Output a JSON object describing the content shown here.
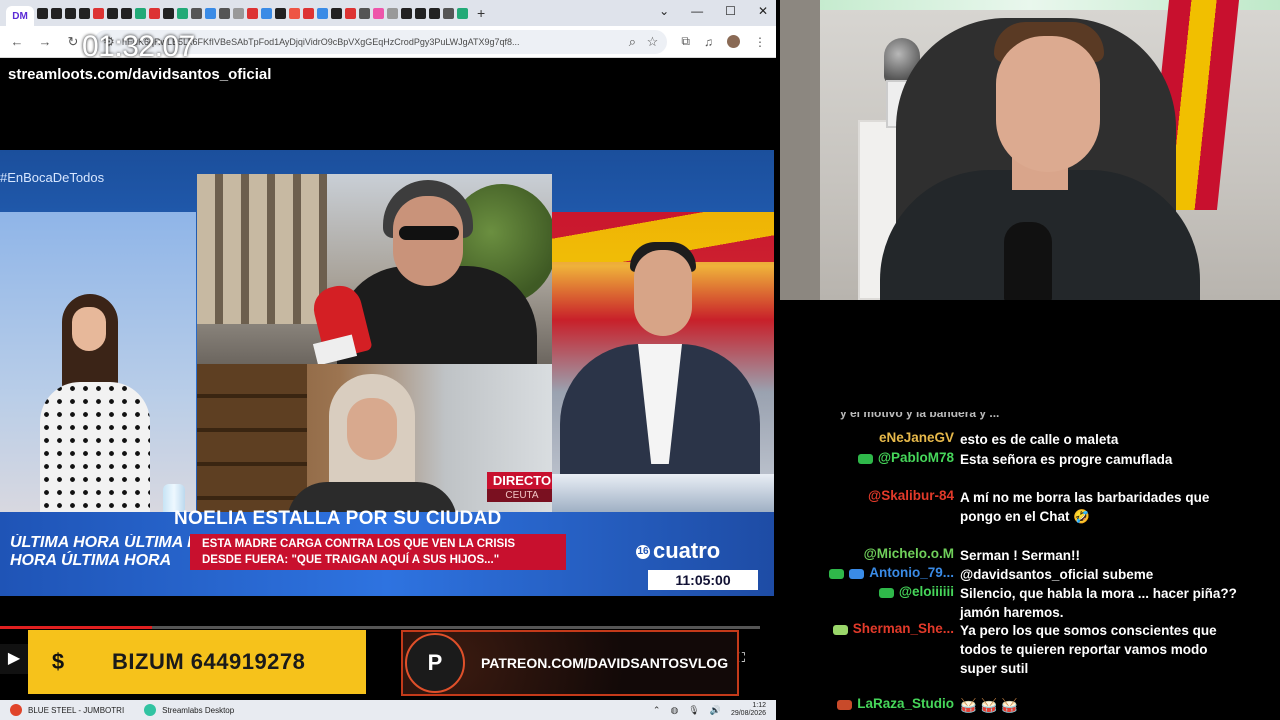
{
  "browser": {
    "url": "hEuK6qRwLB5Lk6FKfIVBeSAbTpFod1AyDjqiVidrO9cBpVXgGEqHzCrodPgy3PuLWJgATX9g7qf8...",
    "active_tab_label": "DM",
    "new_tab_symbol": "+",
    "window_controls": [
      "⌄",
      "—",
      "☐",
      "✕"
    ]
  },
  "overlay": {
    "clock": "01:32:07",
    "streamloots": "streamloots.com/davidsantos_oficial"
  },
  "tv": {
    "hashtag": "#EnBocaDeTodos",
    "ultima_lines": [
      "ÚLTIMA HORA   ÚLTIMA HORA",
      "HORA   ÚLTIMA HORA"
    ],
    "directo": "DIRECTO",
    "location": "CEUTA",
    "headline": "NOELIA ESTALLA POR SU CIUDAD",
    "subheadline": "ESTA MADRE CARGA CONTRA LOS QUE VEN LA CRISIS DESDE FUERA: \"QUE TRAIGAN AQUÍ A SUS HIJOS...\"",
    "channel": "cuatro",
    "channel_badge": "16",
    "time": "11:05:00"
  },
  "player": {
    "progress_fraction": 0.2
  },
  "donations": {
    "bizum_symbol": "$",
    "bizum": "BIZUM 644919278",
    "patreon_symbol": "P",
    "patreon": "PATREON.COM/DAVIDSANTOSVLOG"
  },
  "taskbar": {
    "apps": [
      {
        "label": "BLUE STEEL - JUMBOTRI",
        "color": "#e0442a"
      },
      {
        "label": "Streamlabs Desktop",
        "color": "#31c3a2"
      }
    ],
    "time": "1:12",
    "date": "29/08/2026"
  },
  "chat": {
    "partial_top": "y el motivo y la bandera y ...",
    "messages": [
      {
        "user": "eNeJaneGV",
        "color": "#e6b84a",
        "text": "esto es de calle o maleta",
        "badges": []
      },
      {
        "user": "@PabloM78",
        "color": "#46d65a",
        "text": "Esta señora es progre camuflada",
        "badges": [
          "#2fb84a"
        ]
      },
      {
        "user": "@Skalibur-84",
        "color": "#e23a2a",
        "text": "A mí no me borra las barbaridades que pongo en el Chat 🤣",
        "badges": []
      },
      {
        "user": "@Michelo.o.M",
        "color": "#6fcf5a",
        "text": "Serman ! Serman!!",
        "badges": []
      },
      {
        "user": "Antonio_79...",
        "color": "#3a8be6",
        "text": "@davidsantos_oficial subeme",
        "badges": [
          "#2fb84a",
          "#3a8be6"
        ]
      },
      {
        "user": "@eloiiiiii",
        "color": "#46d65a",
        "text": "Silencio, que habla la mora ... hacer piña?? jamón haremos.",
        "badges": [
          "#2fb84a"
        ]
      },
      {
        "user": "Sherman_She...",
        "color": "#e23a2a",
        "text": "Ya pero los que somos conscientes que todos te quieren reportar vamos modo super sutil",
        "badges": [
          "#9ad66a"
        ]
      },
      {
        "user": "LaRaza_Studio",
        "color": "#46d65a",
        "text": "🥁 🥁 🥁",
        "badges": [
          "#c84a2a"
        ]
      }
    ]
  }
}
